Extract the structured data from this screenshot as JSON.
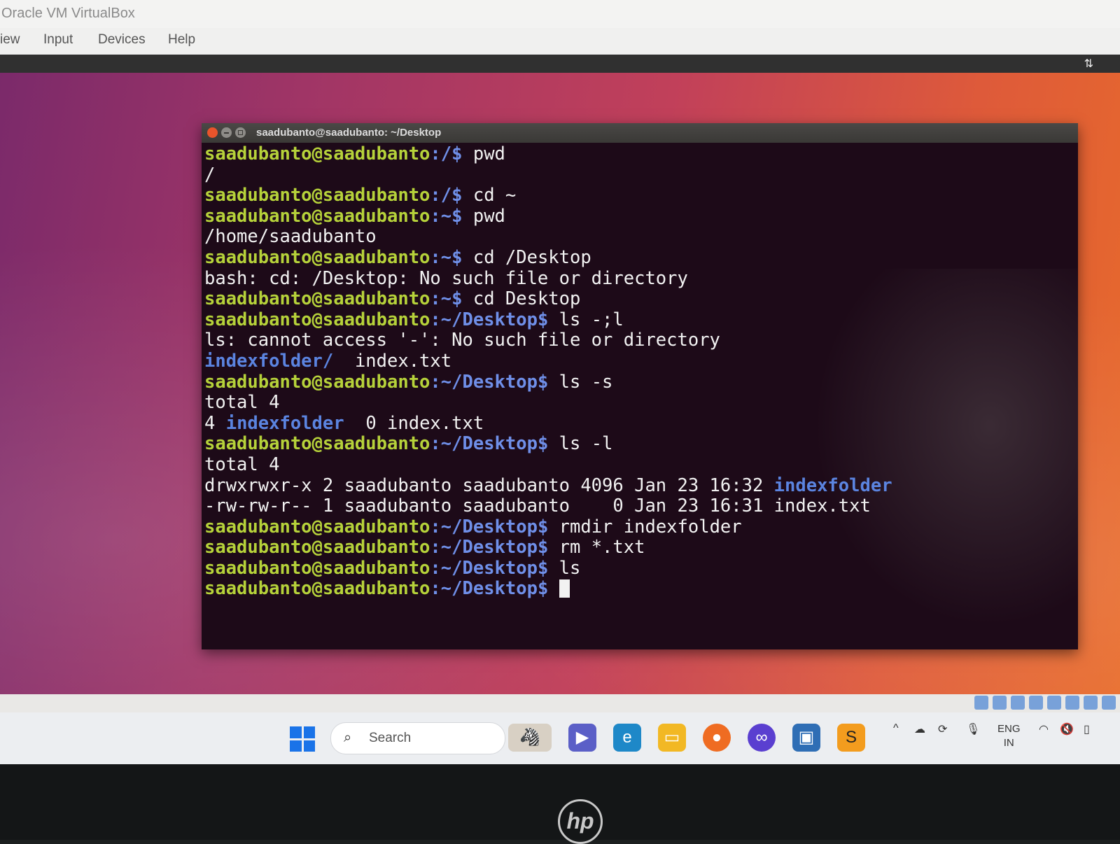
{
  "vbox": {
    "title": "Oracle VM VirtualBox",
    "menu": [
      "iew",
      "Input",
      "Devices",
      "Help"
    ]
  },
  "terminal": {
    "title": "saadubanto@saadubanto: ~/Desktop",
    "lines": [
      {
        "user": "saadubanto@saadubanto",
        "path": ":/",
        "dollar": "$",
        "cmd": " pwd"
      },
      {
        "out": "/"
      },
      {
        "user": "saadubanto@saadubanto",
        "path": ":/",
        "dollar": "$",
        "cmd": " cd ~"
      },
      {
        "user": "saadubanto@saadubanto",
        "path": ":~",
        "dollar": "$",
        "cmd": " pwd"
      },
      {
        "out": "/home/saadubanto"
      },
      {
        "user": "saadubanto@saadubanto",
        "path": ":~",
        "dollar": "$",
        "cmd": " cd /Desktop"
      },
      {
        "out": "bash: cd: /Desktop: No such file or directory"
      },
      {
        "user": "saadubanto@saadubanto",
        "path": ":~",
        "dollar": "$",
        "cmd": " cd Desktop"
      },
      {
        "user": "saadubanto@saadubanto",
        "path": ":~/Desktop",
        "dollar": "$",
        "cmd": " ls -;l"
      },
      {
        "out": "ls: cannot access '-': No such file or directory"
      },
      {
        "dir": "indexfolder/",
        "rest": "  index.txt"
      },
      {
        "user": "saadubanto@saadubanto",
        "path": ":~/Desktop",
        "dollar": "$",
        "cmd": " ls -s"
      },
      {
        "out": "total 4"
      },
      {
        "pre": "4 ",
        "dir": "indexfolder",
        "rest": "  0 index.txt"
      },
      {
        "user": "saadubanto@saadubanto",
        "path": ":~/Desktop",
        "dollar": "$",
        "cmd": " ls -l"
      },
      {
        "out": "total 4"
      },
      {
        "pre": "drwxrwxr-x 2 saadubanto saadubanto 4096 Jan 23 16:32 ",
        "dir": "indexfolder",
        "rest": ""
      },
      {
        "out": "-rw-rw-r-- 1 saadubanto saadubanto    0 Jan 23 16:31 index.txt"
      },
      {
        "user": "saadubanto@saadubanto",
        "path": ":~/Desktop",
        "dollar": "$",
        "cmd": " rmdir indexfolder"
      },
      {
        "user": "saadubanto@saadubanto",
        "path": ":~/Desktop",
        "dollar": "$",
        "cmd": " rm *.txt"
      },
      {
        "user": "saadubanto@saadubanto",
        "path": ":~/Desktop",
        "dollar": "$",
        "cmd": " ls"
      },
      {
        "user": "saadubanto@saadubanto",
        "path": ":~/Desktop",
        "dollar": "$",
        "cmd": " ",
        "cursor": true
      }
    ]
  },
  "taskbar": {
    "search_placeholder": "Search",
    "lang_line1": "ENG",
    "lang_line2": "IN",
    "apps": [
      "zebra-widget-icon",
      "meet-icon",
      "edge-icon",
      "file-explorer-icon",
      "firefox-icon",
      "copilot-icon",
      "virtualbox-icon",
      "sublime-icon"
    ]
  },
  "bezel": {
    "logo": "hp"
  },
  "colors": {
    "user": "#b6d23a",
    "path": "#6f8fe8",
    "dir": "#5b84e0",
    "terminal_bg": "#1d0a18"
  }
}
